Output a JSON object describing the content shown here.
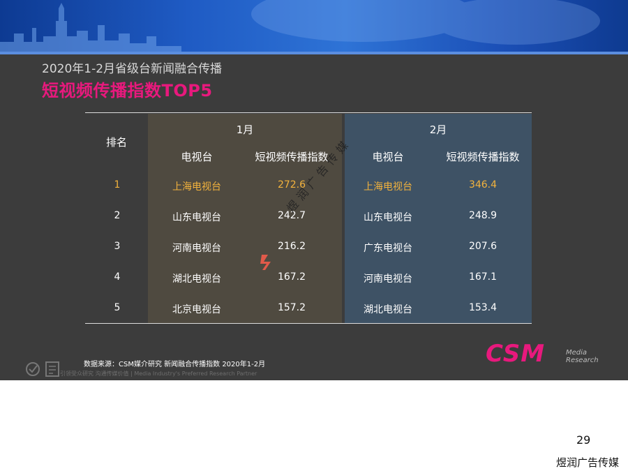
{
  "title": {
    "line1": "2020年1-2月省级台新闻融合传播",
    "line2": "短视频传播指数TOP5"
  },
  "colors": {
    "accent": "#e8197d",
    "highlight": "#f3b33d",
    "slide_bg": "#3c3c3c",
    "jan_bg": "#4f4a40",
    "feb_bg": "#3e5265"
  },
  "table": {
    "rank_header": "排名",
    "months": [
      "1月",
      "2月"
    ],
    "col_station": "电视台",
    "col_index": "短视频传播指数",
    "rows": [
      {
        "rank": "1",
        "jan_station": "上海电视台",
        "jan_value": "272.6",
        "feb_station": "上海电视台",
        "feb_value": "346.4"
      },
      {
        "rank": "2",
        "jan_station": "山东电视台",
        "jan_value": "242.7",
        "feb_station": "山东电视台",
        "feb_value": "248.9"
      },
      {
        "rank": "3",
        "jan_station": "河南电视台",
        "jan_value": "216.2",
        "feb_station": "广东电视台",
        "feb_value": "207.6"
      },
      {
        "rank": "4",
        "jan_station": "湖北电视台",
        "jan_value": "167.2",
        "feb_station": "河南电视台",
        "feb_value": "167.1"
      },
      {
        "rank": "5",
        "jan_station": "北京电视台",
        "jan_value": "157.2",
        "feb_station": "湖北电视台",
        "feb_value": "153.4"
      }
    ]
  },
  "source": "数据来源：CSM媒介研究 新闻融合传播指数 2020年1-2月",
  "tagline": "引领受众研究 沟通传媒价值 | Media Industry's Preferred Research Partner",
  "logo": {
    "mark": "CSM",
    "sub1": "Media",
    "sub2": "Research"
  },
  "watermark": "煜润广告传媒",
  "page_number": "29",
  "footer": "煜润广告传媒"
}
